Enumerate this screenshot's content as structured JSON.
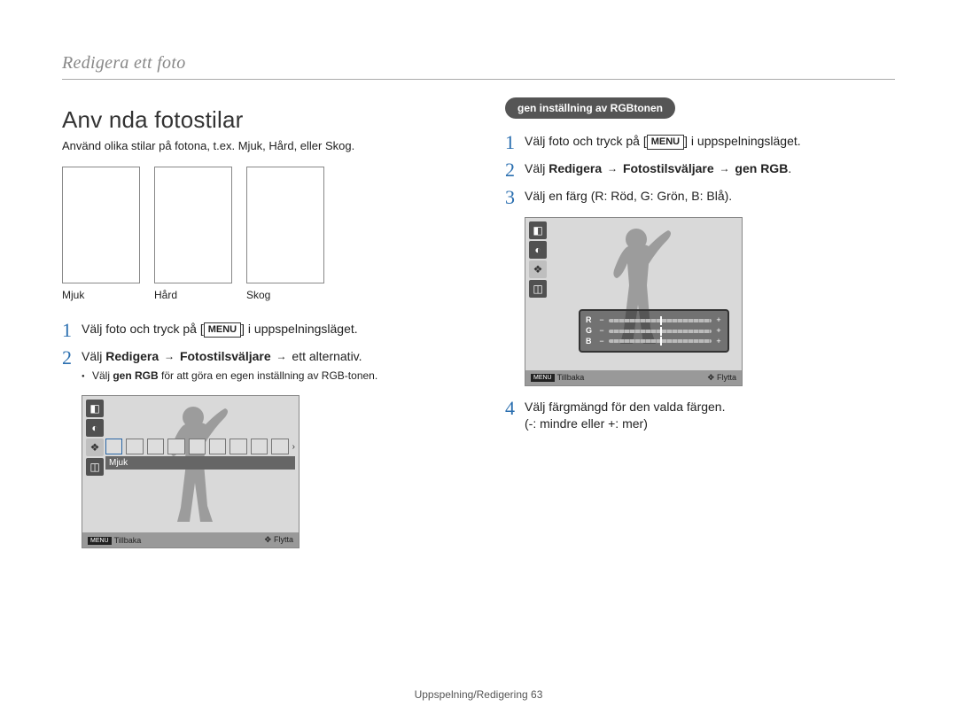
{
  "header": "Redigera ett foto",
  "left": {
    "title": "Anv nda fotostilar",
    "intro": "Använd olika stilar på fotona, t.ex. Mjuk, Hård, eller Skog.",
    "thumb_labels": [
      "Mjuk",
      "Hård",
      "Skog"
    ],
    "steps": [
      {
        "num": "1",
        "pre": "Välj foto och tryck på [",
        "kbd": "MENU",
        "post": "] i uppspelningsläget."
      },
      {
        "num": "2",
        "pre": "Välj ",
        "b1": "Redigera",
        "mid1": " ",
        "arrow1": "→",
        "mid2": " ",
        "b2": "Fotostilsväljare",
        "mid3": " ",
        "arrow2": "→",
        "post": " ett alternativ.",
        "sub_pre": "Välj ",
        "sub_b": "gen RGB",
        "sub_post": " för att göra en egen inställning av RGB-tonen."
      }
    ],
    "device": {
      "label": "Mjuk",
      "footer_back_label": "Tillbaka",
      "footer_move_label": "Flytta",
      "menu_chip": "MENU"
    }
  },
  "right": {
    "pill": "gen inställning av RGBtonen",
    "steps": [
      {
        "num": "1",
        "pre": "Välj foto och tryck på [",
        "kbd": "MENU",
        "post": "] i uppspelningsläget."
      },
      {
        "num": "2",
        "pre": "Välj ",
        "b1": "Redigera",
        "arrow1": "→",
        "b2": "Fotostilsväljare",
        "arrow2": "→",
        "b3": "gen RGB",
        "post": "."
      },
      {
        "num": "3",
        "text": "Välj en färg (R: Röd, G: Grön, B: Blå)."
      },
      {
        "num": "4",
        "text": "Välj färgmängd för den valda färgen.",
        "text2": "(-: mindre eller +: mer)"
      }
    ],
    "device": {
      "rgb_rows": [
        "R",
        "G",
        "B"
      ],
      "footer_back_label": "Tillbaka",
      "footer_move_label": "Flytta",
      "menu_chip": "MENU"
    }
  },
  "footer": {
    "section": "Uppspelning/Redigering",
    "page": "63"
  }
}
